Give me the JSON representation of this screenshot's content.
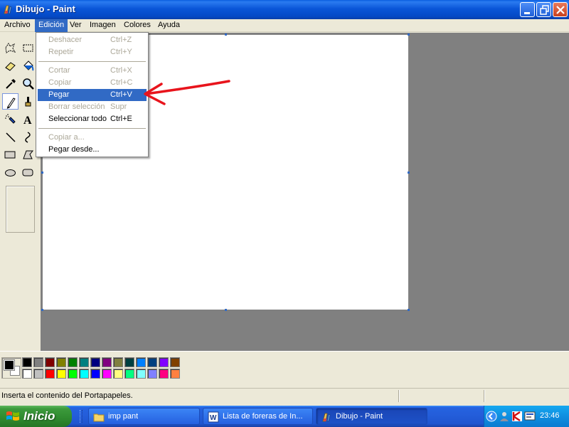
{
  "window": {
    "title": "Dibujo - Paint",
    "controls": [
      "minimize-icon",
      "restore-icon",
      "close-icon"
    ]
  },
  "menubar": {
    "items": [
      {
        "label": "Archivo"
      },
      {
        "label": "Edición",
        "active": true
      },
      {
        "label": "Ver"
      },
      {
        "label": "Imagen"
      },
      {
        "label": "Colores"
      },
      {
        "label": "Ayuda"
      }
    ]
  },
  "edit_menu": {
    "items": [
      {
        "label": "Deshacer",
        "shortcut": "Ctrl+Z",
        "enabled": false
      },
      {
        "label": "Repetir",
        "shortcut": "Ctrl+Y",
        "enabled": false
      },
      {
        "label": "Cortar",
        "shortcut": "Ctrl+X",
        "enabled": false
      },
      {
        "label": "Copiar",
        "shortcut": "Ctrl+C",
        "enabled": false
      },
      {
        "label": "Pegar",
        "shortcut": "Ctrl+V",
        "enabled": true,
        "highlighted": true
      },
      {
        "label": "Borrar selección",
        "shortcut": "Supr",
        "enabled": false
      },
      {
        "label": "Seleccionar todo",
        "shortcut": "Ctrl+E",
        "enabled": true
      },
      {
        "label": "Copiar a...",
        "shortcut": "",
        "enabled": false
      },
      {
        "label": "Pegar desde...",
        "shortcut": "",
        "enabled": true
      }
    ]
  },
  "toolbox": {
    "tools": [
      "free-select-icon",
      "rect-select-icon",
      "eraser-icon",
      "fill-icon",
      "color-picker-icon",
      "magnifier-icon",
      "pencil-icon",
      "brush-icon",
      "airbrush-icon",
      "text-icon",
      "line-icon",
      "curve-icon",
      "rectangle-icon",
      "polygon-icon",
      "ellipse-icon",
      "rounded-rect-icon"
    ],
    "selected": "pencil-icon"
  },
  "palette": {
    "foreground": "#000000",
    "background": "#ffffff",
    "top_row": [
      "#000000",
      "#808080",
      "#800000",
      "#808000",
      "#008000",
      "#008080",
      "#000080",
      "#800080",
      "#808040",
      "#004040",
      "#0080ff",
      "#004080",
      "#8000ff",
      "#804000"
    ],
    "bottom_row": [
      "#ffffff",
      "#c0c0c0",
      "#ff0000",
      "#ffff00",
      "#00ff00",
      "#00ffff",
      "#0000ff",
      "#ff00ff",
      "#ffff80",
      "#00ff80",
      "#80ffff",
      "#8080ff",
      "#ff0080",
      "#ff8040"
    ]
  },
  "statusbar": {
    "text": "Inserta el contenido del Portapapeles."
  },
  "annotation": {
    "color": "#e8141c"
  },
  "taskbar": {
    "start_label": "Inicio",
    "tasks": [
      {
        "label": "imp pant",
        "icon": "folder-icon"
      },
      {
        "label": "Lista de foreras de In...",
        "icon": "word-icon"
      },
      {
        "label": "Dibujo - Paint",
        "icon": "paint-icon",
        "active": true
      }
    ],
    "clock": "23:46"
  }
}
